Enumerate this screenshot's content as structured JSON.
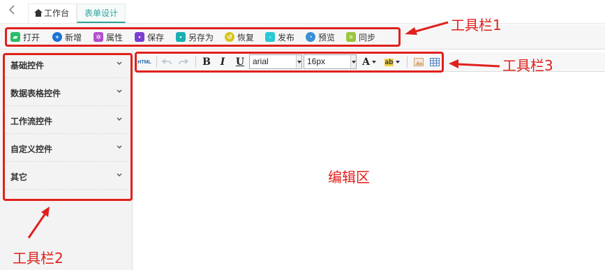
{
  "tabs": {
    "home_label": "工作台",
    "active_label": "表单设计"
  },
  "toolbar1": {
    "items": [
      {
        "label": "打开",
        "icon": "folder-open-icon",
        "color": "#2bbd6a"
      },
      {
        "label": "新增",
        "icon": "plus-circle-icon",
        "color": "#1b73d6"
      },
      {
        "label": "属性",
        "icon": "properties-icon",
        "color": "#b24fcf"
      },
      {
        "label": "保存",
        "icon": "save-icon",
        "color": "#7b3fd1"
      },
      {
        "label": "另存为",
        "icon": "save-as-icon",
        "color": "#1ab0b3"
      },
      {
        "label": "恢复",
        "icon": "restore-icon",
        "color": "#d8c31a"
      },
      {
        "label": "发布",
        "icon": "publish-icon",
        "color": "#26c9d4"
      },
      {
        "label": "预览",
        "icon": "preview-icon",
        "color": "#3a8fd6"
      },
      {
        "label": "同步",
        "icon": "sync-icon",
        "color": "#9bc53d"
      }
    ]
  },
  "sidebar": {
    "items": [
      {
        "label": "基础控件"
      },
      {
        "label": "数据表格控件"
      },
      {
        "label": "工作流控件"
      },
      {
        "label": "自定义控件"
      },
      {
        "label": "其它"
      }
    ]
  },
  "editor_toolbar": {
    "html_label": "HTML",
    "bold": "B",
    "italic": "I",
    "underline": "U",
    "font_family": "arial",
    "font_size": "16px",
    "font_color": "A",
    "highlight": "ab"
  },
  "annotations": {
    "toolbar1": "工具栏1",
    "toolbar2": "工具栏2",
    "toolbar3": "工具栏3",
    "editor": "编辑区"
  },
  "colors": {
    "accent": "#2aa39a",
    "annotation_red": "#e0201c"
  }
}
